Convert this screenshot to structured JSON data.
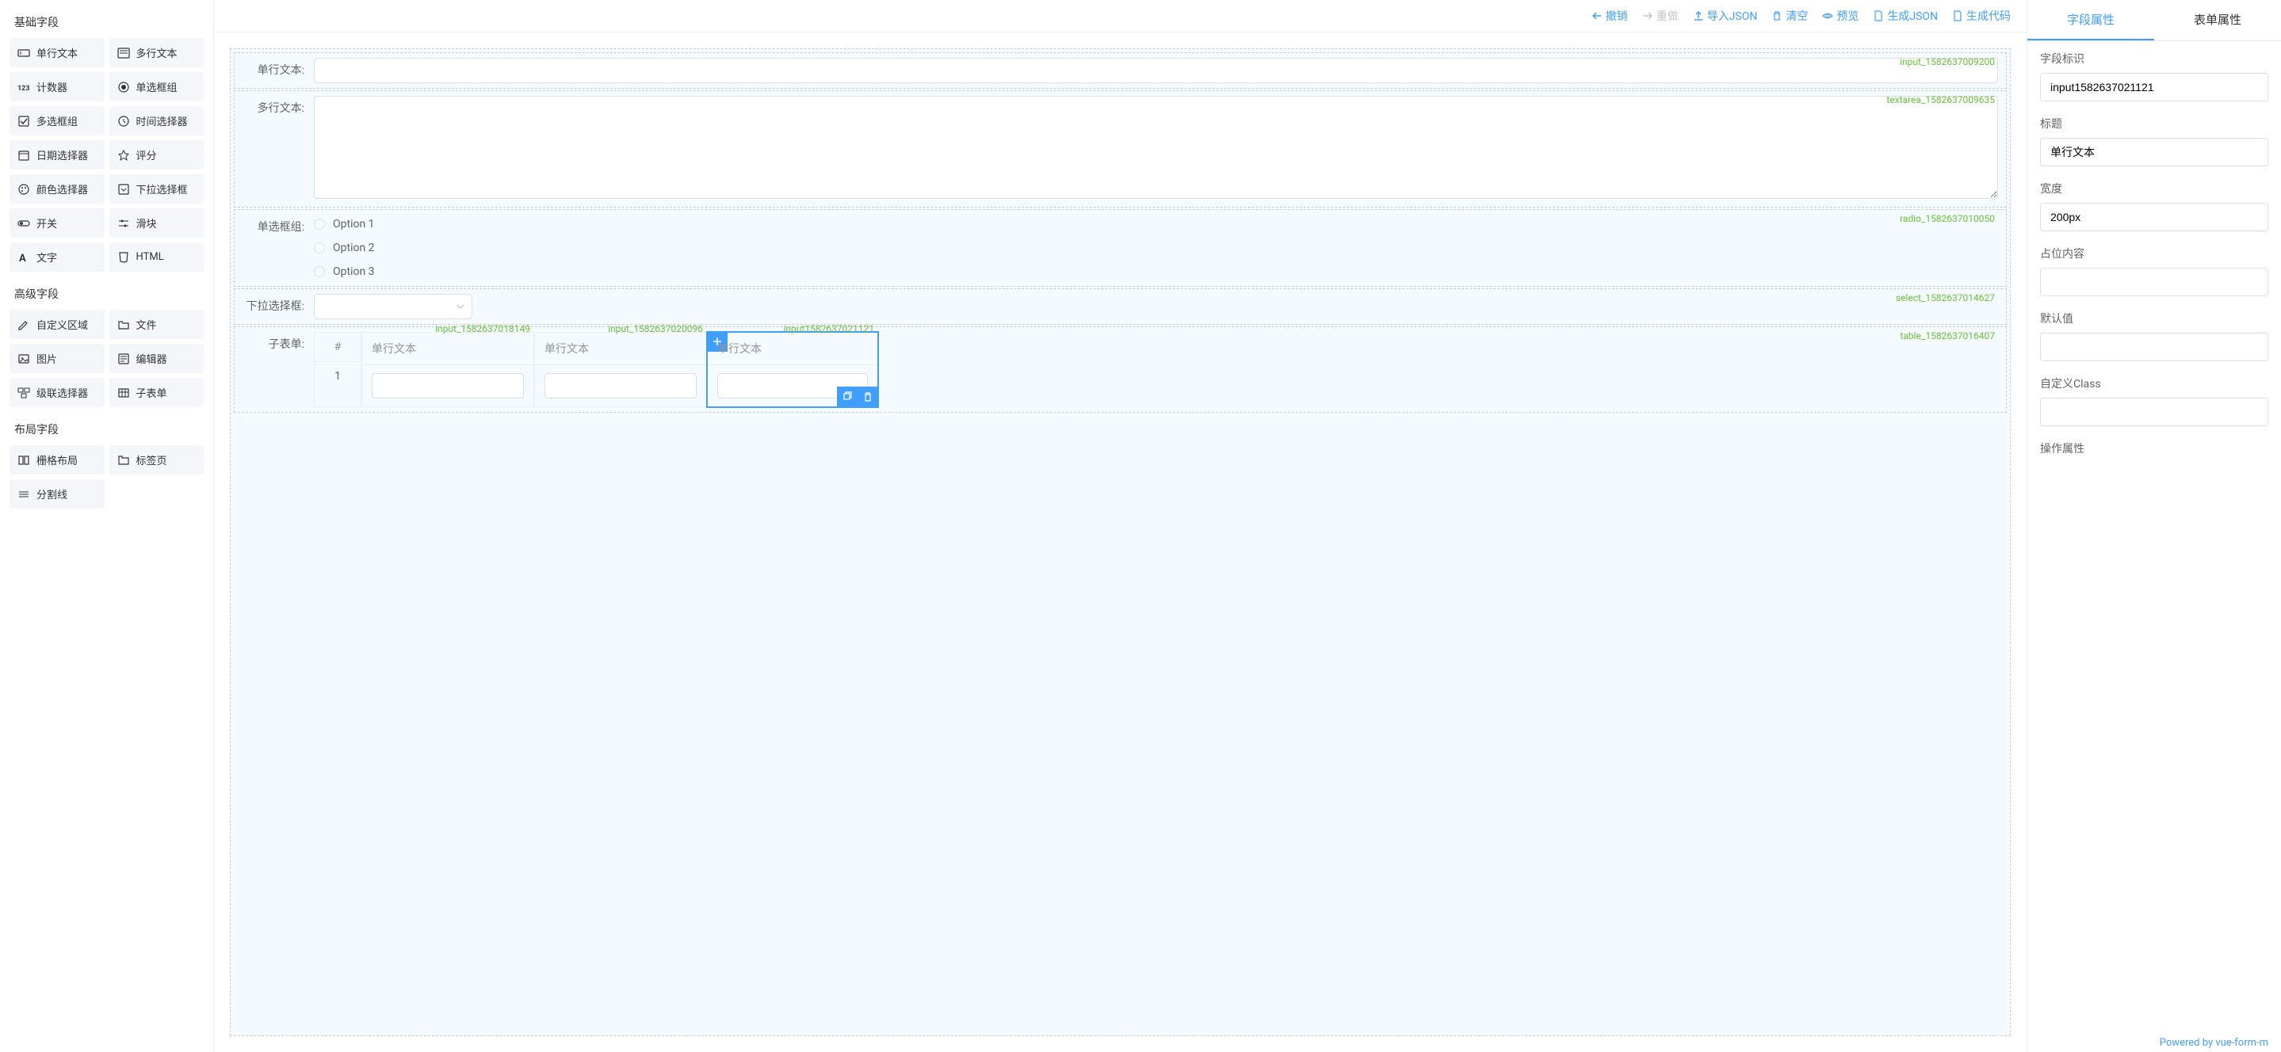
{
  "sidebar": {
    "sections": [
      {
        "title": "基础字段",
        "items": [
          {
            "label": "单行文本",
            "icon": "text-input"
          },
          {
            "label": "多行文本",
            "icon": "textarea"
          },
          {
            "label": "计数器",
            "icon": "counter"
          },
          {
            "label": "单选框组",
            "icon": "radio"
          },
          {
            "label": "多选框组",
            "icon": "checkbox"
          },
          {
            "label": "时间选择器",
            "icon": "time"
          },
          {
            "label": "日期选择器",
            "icon": "date"
          },
          {
            "label": "评分",
            "icon": "star"
          },
          {
            "label": "颜色选择器",
            "icon": "color"
          },
          {
            "label": "下拉选择框",
            "icon": "select"
          },
          {
            "label": "开关",
            "icon": "switch"
          },
          {
            "label": "滑块",
            "icon": "slider"
          },
          {
            "label": "文字",
            "icon": "text"
          },
          {
            "label": "HTML",
            "icon": "html"
          }
        ]
      },
      {
        "title": "高级字段",
        "items": [
          {
            "label": "自定义区域",
            "icon": "custom"
          },
          {
            "label": "文件",
            "icon": "file"
          },
          {
            "label": "图片",
            "icon": "image"
          },
          {
            "label": "编辑器",
            "icon": "editor"
          },
          {
            "label": "级联选择器",
            "icon": "cascader"
          },
          {
            "label": "子表单",
            "icon": "subform"
          }
        ]
      },
      {
        "title": "布局字段",
        "items": [
          {
            "label": "栅格布局",
            "icon": "grid"
          },
          {
            "label": "标签页",
            "icon": "tabs"
          },
          {
            "label": "分割线",
            "icon": "divider"
          }
        ]
      }
    ]
  },
  "toolbar": {
    "undo": "撤销",
    "redo": "重做",
    "import": "导入JSON",
    "clear": "清空",
    "preview": "预览",
    "genJson": "生成JSON",
    "genCode": "生成代码"
  },
  "canvas": {
    "fields": [
      {
        "label": "单行文本:",
        "id": "input_1582637009200",
        "type": "input"
      },
      {
        "label": "多行文本:",
        "id": "textarea_1582637009635",
        "type": "textarea"
      },
      {
        "label": "单选框组:",
        "id": "radio_1582637010050",
        "type": "radio",
        "options": [
          "Option 1",
          "Option 2",
          "Option 3"
        ]
      },
      {
        "label": "下拉选择框:",
        "id": "select_1582637014627",
        "type": "select"
      },
      {
        "label": "子表单:",
        "id": "table_1582637016407",
        "type": "subform"
      }
    ],
    "subform": {
      "hashHeader": "#",
      "rowNum": "1",
      "columns": [
        {
          "id": "input_1582637018149",
          "header": "单行文本"
        },
        {
          "id": "input_1582637020096",
          "header": "单行文本"
        },
        {
          "id": "input1582637021121",
          "header": "单行文本",
          "selected": true
        }
      ]
    }
  },
  "props": {
    "tabs": {
      "field": "字段属性",
      "form": "表单属性"
    },
    "fieldId": {
      "label": "字段标识",
      "value": "input1582637021121"
    },
    "title": {
      "label": "标题",
      "value": "单行文本"
    },
    "width": {
      "label": "宽度",
      "value": "200px"
    },
    "placeholder": {
      "label": "占位内容",
      "value": ""
    },
    "defaultValue": {
      "label": "默认值",
      "value": ""
    },
    "customClass": {
      "label": "自定义Class",
      "value": ""
    },
    "operationAttr": {
      "label": "操作属性"
    }
  },
  "footer": {
    "powered": "Powered by vue-form-m"
  }
}
